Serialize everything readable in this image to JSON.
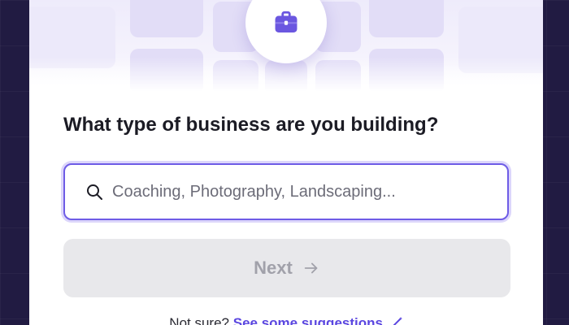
{
  "onboarding": {
    "question": "What type of business are you building?",
    "search": {
      "value": "",
      "placeholder": "Coaching, Photography, Landscaping..."
    },
    "next_button": {
      "label": "Next",
      "enabled": false
    },
    "footer": {
      "prompt": "Not sure?",
      "link_label": "See some suggestions"
    }
  },
  "icons": {
    "badge": "briefcase-icon",
    "search": "search-icon",
    "next": "arrow-right-icon",
    "link": "magic-wand-icon"
  },
  "colors": {
    "accent": "#6e5ce6",
    "accent_soft": "#dcd6fb",
    "briefcase": "#6b57e0",
    "button_disabled_bg": "#e8e8eb",
    "button_disabled_text": "#a1a1aa",
    "link": "#5b47e0",
    "background": "#211b42"
  }
}
